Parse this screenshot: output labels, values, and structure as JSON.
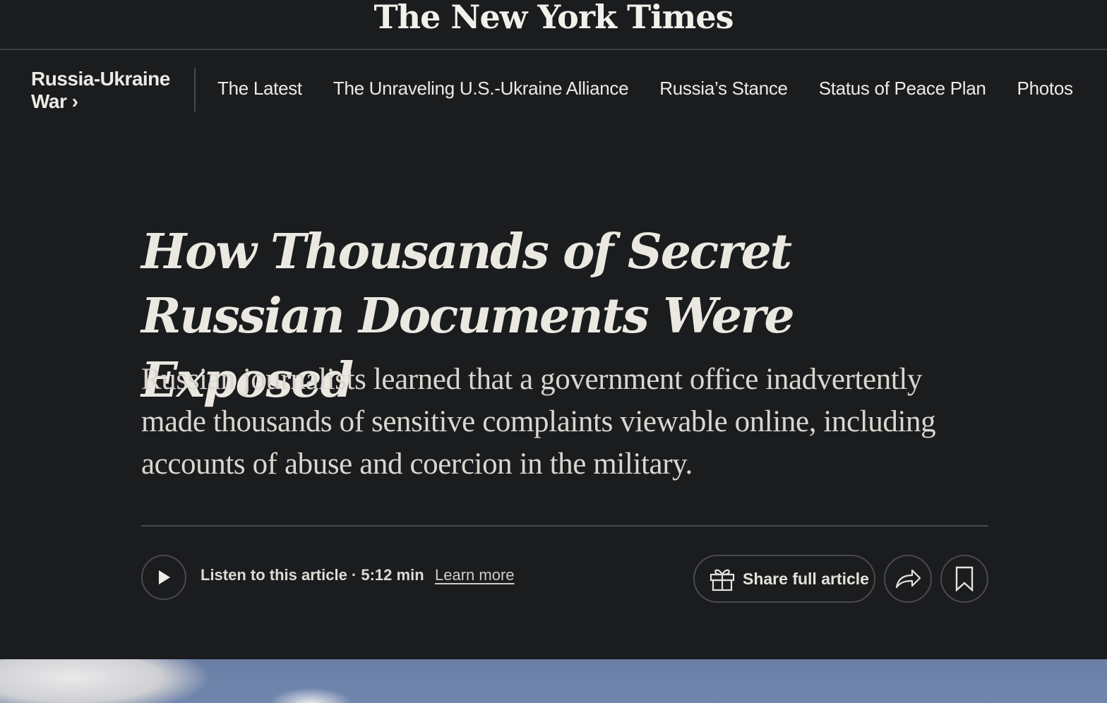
{
  "masthead": {
    "logo_text": "The New York Times"
  },
  "nav": {
    "section": "Russia-Ukraine War ›",
    "items": [
      {
        "label": "The Latest"
      },
      {
        "label": "The Unraveling U.S.-Ukraine Alliance"
      },
      {
        "label": "Russia’s Stance"
      },
      {
        "label": "Status of Peace Plan"
      },
      {
        "label": "Photos"
      }
    ]
  },
  "article": {
    "headline": "How Thousands of Secret Russian Documents Were Exposed",
    "summary": "Russian journalists learned that a government office inadvertently made thousands of sensitive complaints viewable online, including accounts of abuse and coercion in the military."
  },
  "tools": {
    "listen_text": "Listen to this article · 5:12 min",
    "learn_more": "Learn more",
    "share_label": "Share full article"
  },
  "icons": {
    "play": "play-icon",
    "gift": "gift-icon",
    "share": "share-arrow-icon",
    "bookmark": "bookmark-icon"
  },
  "colors": {
    "background": "#1b1c1e",
    "text": "#e8e6e1",
    "border": "#4a4b4d"
  }
}
